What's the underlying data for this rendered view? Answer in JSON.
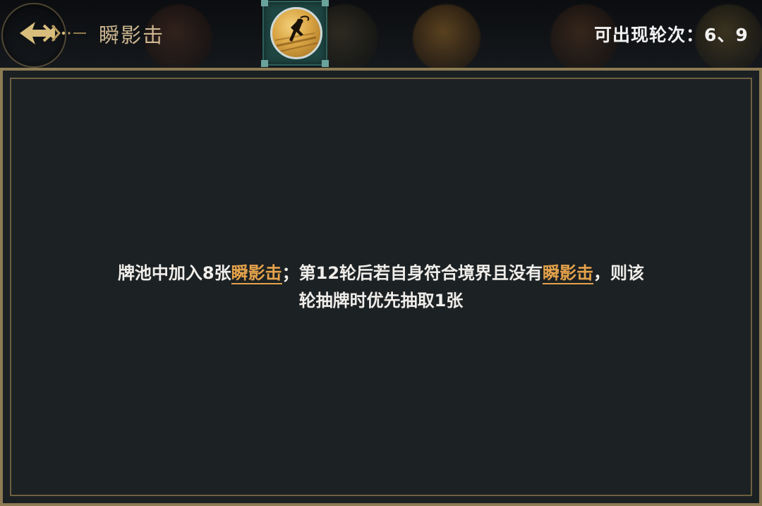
{
  "header": {
    "title": "瞬影击",
    "rounds_label": "可出现轮次：6、9",
    "skill_icon": "skill-dash-figure-icon",
    "back_icon": "ornate-arrow-left-icon"
  },
  "description": {
    "part1": "牌池中加入8张",
    "keyword1": "瞬影击",
    "part2": "；第12轮后若自身符合境界且没有",
    "keyword2": "瞬影击",
    "part3": "，则该\n轮抽牌时优先抽取1张"
  },
  "colors": {
    "accent_gold": "#e4a24a",
    "title_gold": "#cdb690",
    "frame_gold": "#8d7b54",
    "panel_bg": "#1c2124",
    "icon_frame_teal": "#1f4744"
  }
}
